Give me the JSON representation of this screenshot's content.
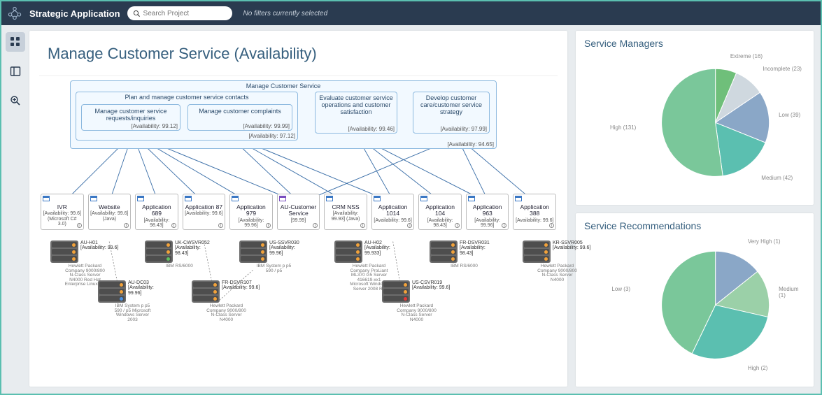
{
  "header": {
    "app_name": "Strategic Application",
    "search_placeholder": "Search Project",
    "filter_text": "No filters currently selected"
  },
  "page": {
    "title": "Manage Customer Service (Availability)"
  },
  "hierarchy": {
    "root": {
      "label": "Manage Customer Service",
      "availability": "[Availability: 94.65]"
    },
    "plan_group": {
      "label": "Plan and manage customer service contacts",
      "availability": "[Availability: 97.12]"
    },
    "requests": {
      "label": "Manage customer service requests/inquiries",
      "availability": "[Availability: 99.12]"
    },
    "complaints": {
      "label": "Manage customer complaints",
      "availability": "[Availability: 99.99]"
    },
    "evaluate": {
      "label": "Evaluate customer service operations and customer satisfaction",
      "availability": "[Availability: 99.46]"
    },
    "develop": {
      "label": "Develop customer care/customer service strategy",
      "availability": "[Availability: 97.99]"
    }
  },
  "apps": [
    {
      "name": "IVR",
      "meta": "[Availability: 99.6] (Microsoft C# 3.0)"
    },
    {
      "name": "Website",
      "meta": "[Availability: 99.6] (Java)"
    },
    {
      "name": "Application 689",
      "meta": "[Availability: 98.43]"
    },
    {
      "name": "Application 87",
      "meta": "[Availability: 99.6]"
    },
    {
      "name": "Application 979",
      "meta": "[Availability: 99.96]"
    },
    {
      "name": "AU-Customer Service",
      "meta": "[99.99]",
      "purple": true
    },
    {
      "name": "CRM NSS",
      "meta": "[Availability: 99.93] (Java)"
    },
    {
      "name": "Application 1014",
      "meta": "[Availability: 99.6]"
    },
    {
      "name": "Application 104",
      "meta": "[Availability: 98.43]"
    },
    {
      "name": "Application 963",
      "meta": "[Availability: 99.96]"
    },
    {
      "name": "Application 388",
      "meta": "[Availability: 99.6]"
    }
  ],
  "servers": [
    {
      "col": 0,
      "leds": [
        "o",
        "o",
        "o"
      ],
      "name": "AU-H01",
      "avail": "[Availability: 99.6]",
      "meta": "Hewlett Packard Company 9000/800 N-Class Server N4000 Red Hat Enterprise Linux 5.x"
    },
    {
      "col": 1,
      "leds": [
        "o",
        "o",
        "b"
      ],
      "name": "AU-DC03",
      "avail": "[Availability: 99.96]",
      "meta": "IBM System p p5 590 / p5 Microsoft Windows Server 2003"
    },
    {
      "col": 2,
      "leds": [
        "o",
        "o",
        "g"
      ],
      "name": "UK-CWSVR052",
      "avail": "[Availability: 98.43]",
      "meta": "IBM RS/6000"
    },
    {
      "col": 3,
      "leds": [
        "o",
        "o",
        "o"
      ],
      "name": "FR-DSVR107",
      "avail": "[Availability: 99.6]",
      "meta": "Hewlett Packard Company 9000/800 N-Class Server N4000"
    },
    {
      "col": 4,
      "leds": [
        "o",
        "o",
        "o"
      ],
      "name": "US-SSVR030",
      "avail": "[Availability: 99.96]",
      "meta": "IBM System p p5 590 / p5"
    },
    {
      "col": 6,
      "leds": [
        "o",
        "o",
        "o"
      ],
      "name": "AU-H02",
      "avail": "[Availability: 99.933]",
      "meta": "Hewlett Packard Company ProLiant ML370 G5 Server 416619-xx1 Microsoft Windows Server 2008 R2"
    },
    {
      "col": 7,
      "leds": [
        "o",
        "o",
        "r"
      ],
      "name": "US-CSVR019",
      "avail": "[Availability: 99.6]",
      "meta": "Hewlett Packard Company 9000/800 N-Class Server N4000"
    },
    {
      "col": 8,
      "leds": [
        "o",
        "o",
        "o"
      ],
      "name": "FR-DSVR031",
      "avail": "[Availability: 98.43]",
      "meta": "IBM RS/6000"
    },
    {
      "col": 10,
      "leds": [
        "o",
        "o",
        "o"
      ],
      "name": "KR-SSVR005",
      "avail": "[Availability: 99.6]",
      "meta": "Hewlett Packard Company 9000/800 N-Class Server N4000"
    }
  ],
  "charts": {
    "managers": {
      "title": "Service Managers"
    },
    "recommendations": {
      "title": "Service Recommendations"
    }
  },
  "chart_data": [
    {
      "type": "pie",
      "title": "Service Managers",
      "series": [
        {
          "name": "Extreme",
          "value": 16,
          "color": "#6fbf7a"
        },
        {
          "name": "Incomplete",
          "value": 23,
          "color": "#cfd8df"
        },
        {
          "name": "Low",
          "value": 39,
          "color": "#8aa7c7"
        },
        {
          "name": "Medium",
          "value": 42,
          "color": "#5bbfb0"
        },
        {
          "name": "High",
          "value": 131,
          "color": "#7ac79a"
        }
      ],
      "legend_labels": {
        "Extreme": "Extreme (16)",
        "Incomplete": "Incomplete (23)",
        "Low": "Low (39)",
        "Medium": "Medium (42)",
        "High": "High (131)"
      }
    },
    {
      "type": "pie",
      "title": "Service Recommendations",
      "series": [
        {
          "name": "Very High",
          "value": 1,
          "color": "#8aa7c7"
        },
        {
          "name": "Medium",
          "value": 1,
          "color": "#9bd0a8"
        },
        {
          "name": "High",
          "value": 2,
          "color": "#5bbfb0"
        },
        {
          "name": "Low",
          "value": 3,
          "color": "#7ac79a"
        }
      ],
      "legend_labels": {
        "Very High": "Very High (1)",
        "Medium": "Medium (1)",
        "High": "High (2)",
        "Low": "Low (3)"
      }
    }
  ]
}
